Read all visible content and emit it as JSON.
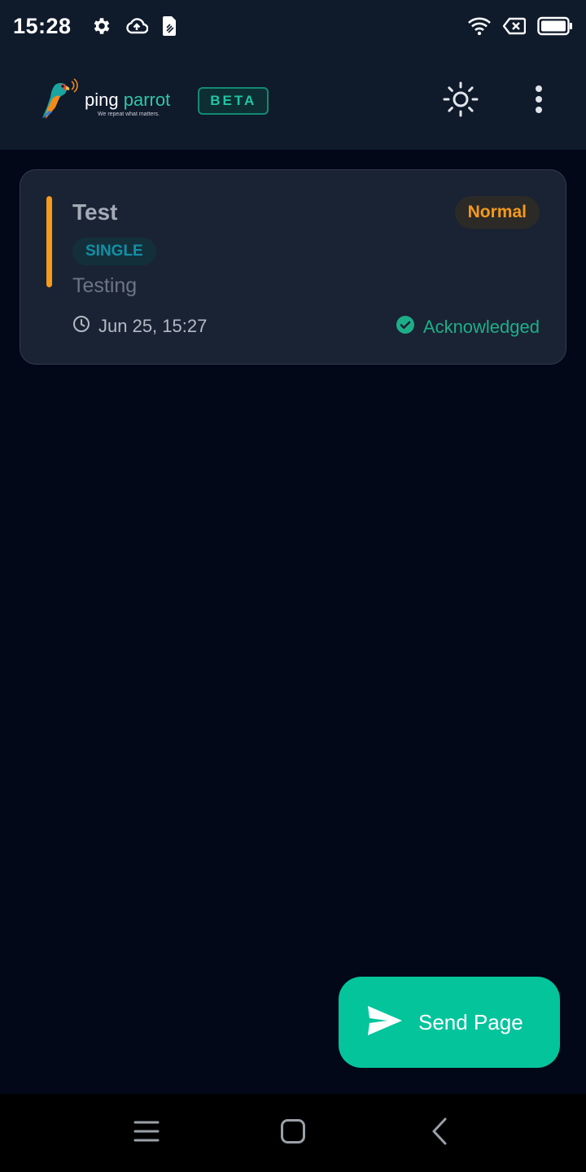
{
  "status_bar": {
    "time": "15:28",
    "left_icons": [
      "settings-icon",
      "cloud-upload-icon",
      "sim-card-icon"
    ],
    "right_icons": [
      "wifi-icon",
      "no-sim-icon",
      "battery-icon"
    ]
  },
  "app_bar": {
    "logo": {
      "name_part1": "ping",
      "name_part2": "parrot",
      "tagline": "We repeat what matters."
    },
    "beta_label": "BETA",
    "actions": [
      "theme-toggle-icon",
      "more-options-icon"
    ]
  },
  "pages": [
    {
      "title": "Test",
      "priority": "Normal",
      "type": "SINGLE",
      "message": "Testing",
      "timestamp": "Jun 25, 15:27",
      "status": "Acknowledged",
      "accent_color": "#f59a1b"
    }
  ],
  "fab": {
    "label": "Send Page",
    "icon": "send-icon"
  },
  "nav_bar": [
    "recent-apps-icon",
    "home-icon",
    "back-icon"
  ],
  "colors": {
    "background": "#020818",
    "surface": "#1a2333",
    "accent": "#04c49c",
    "priority_normal": "#f59a1b",
    "status_ack": "#1dae88"
  }
}
